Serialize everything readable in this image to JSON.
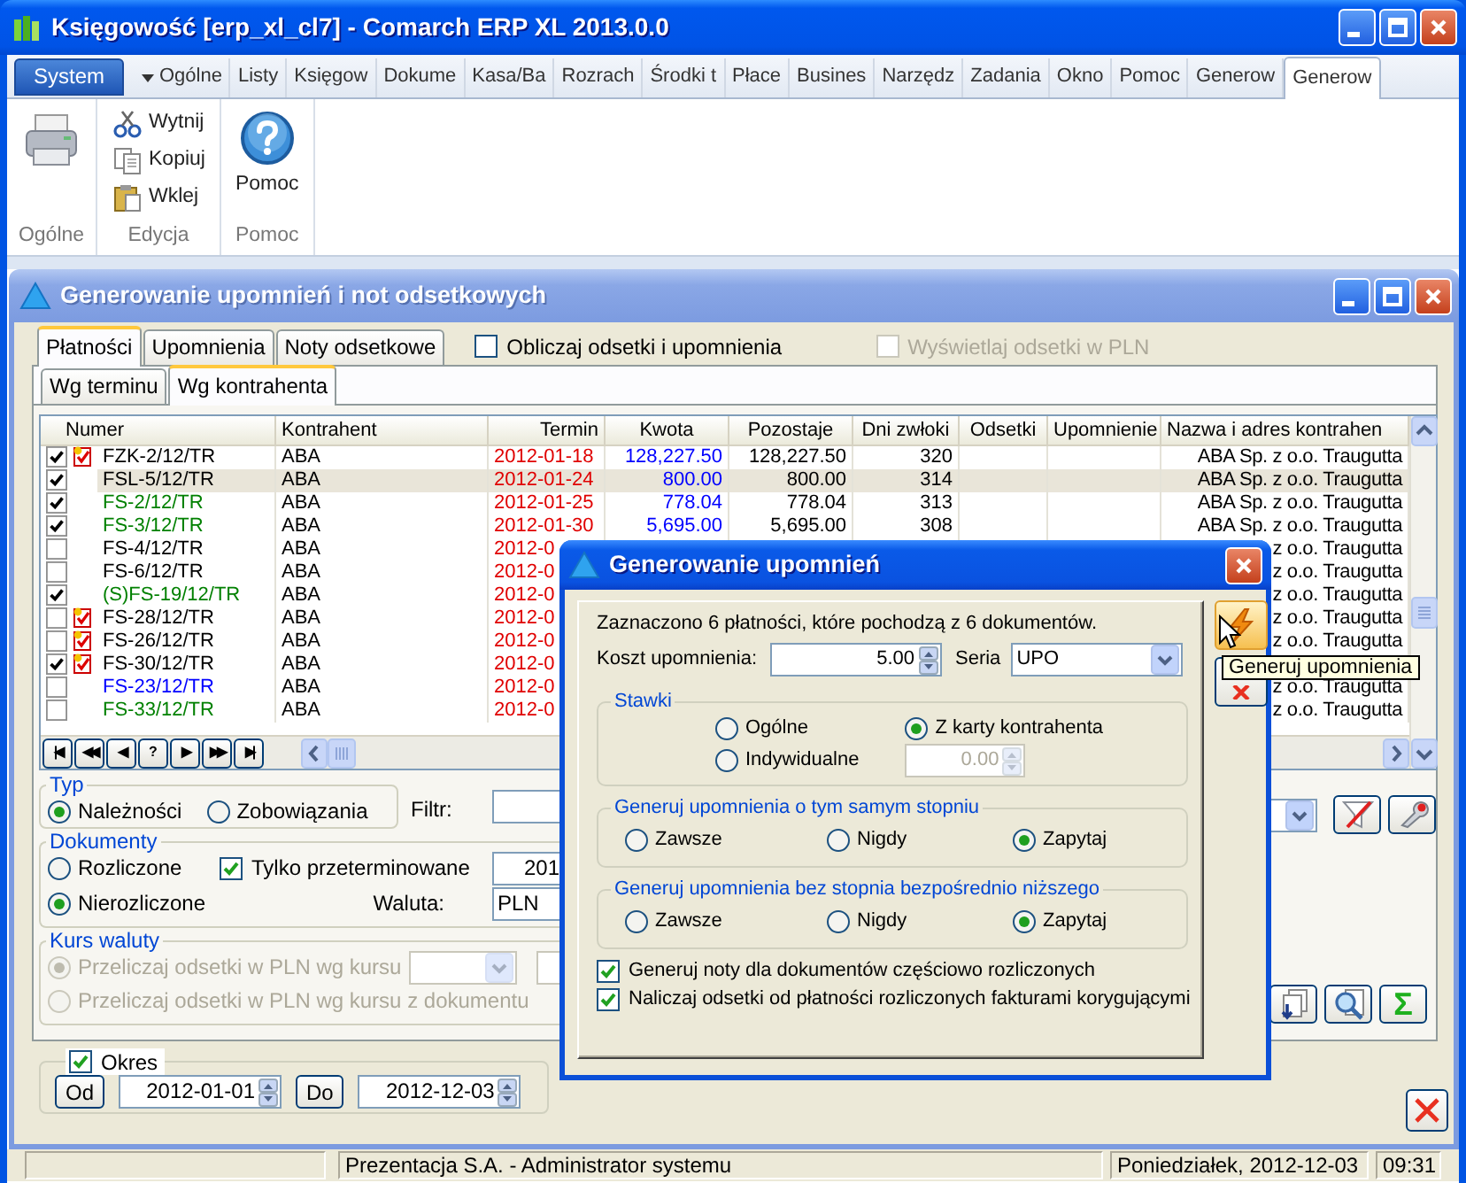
{
  "window": {
    "title": "Księgowość [erp_xl_cl7] - Comarch ERP XL 2013.0.0"
  },
  "ribbon": {
    "system_button": "System",
    "tabs": [
      {
        "label": "Ogólne",
        "kind": "menu",
        "selected": false
      },
      {
        "label": "Listy",
        "kind": "tab",
        "selected": false
      },
      {
        "label": "Księgow",
        "kind": "tab",
        "selected": false
      },
      {
        "label": "Dokume",
        "kind": "tab",
        "selected": false
      },
      {
        "label": "Kasa/Ba",
        "kind": "tab",
        "selected": false
      },
      {
        "label": "Rozrach",
        "kind": "tab",
        "selected": false
      },
      {
        "label": "Środki t",
        "kind": "tab",
        "selected": false
      },
      {
        "label": "Płace",
        "kind": "tab",
        "selected": false
      },
      {
        "label": "Busines",
        "kind": "tab",
        "selected": false
      },
      {
        "label": "Narzędz",
        "kind": "tab",
        "selected": false
      },
      {
        "label": "Zadania",
        "kind": "tab",
        "selected": false
      },
      {
        "label": "Okno",
        "kind": "tab",
        "selected": false
      },
      {
        "label": "Pomoc",
        "kind": "tab",
        "selected": false
      },
      {
        "label": "Generow",
        "kind": "tab",
        "selected": false
      },
      {
        "label": "Generow",
        "kind": "tab",
        "selected": true
      }
    ],
    "groups": [
      {
        "label": "Ogólne",
        "items": [
          {
            "kind": "large"
          }
        ]
      },
      {
        "label": "Edycja",
        "items": [
          {
            "kind": "small",
            "label": "Wytnij"
          },
          {
            "kind": "small",
            "label": "Kopiuj"
          },
          {
            "kind": "small",
            "label": "Wklej"
          }
        ]
      },
      {
        "label": "Pomoc",
        "items": [
          {
            "kind": "large",
            "label": "Pomoc"
          }
        ]
      }
    ]
  },
  "inner_window": {
    "title": "Generowanie upomnień i not odsetkowych",
    "tabs": [
      {
        "label": "Płatności",
        "selected": true
      },
      {
        "label": "Upomnienia",
        "selected": false
      },
      {
        "label": "Noty odsetkowe",
        "selected": false
      }
    ],
    "options": [
      {
        "label": "Obliczaj odsetki i upomnienia",
        "checked": false,
        "disabled": false
      },
      {
        "label": "Wyświetlaj odsetki w PLN",
        "checked": false,
        "disabled": true
      }
    ],
    "subtabs": [
      {
        "label": "Wg terminu",
        "selected": false
      },
      {
        "label": "Wg kontrahenta",
        "selected": true
      }
    ],
    "table": {
      "columns": [
        "Numer",
        "Kontrahent",
        "Termin",
        "Kwota",
        "Pozostaje",
        "Dni zwłoki",
        "Odsetki",
        "Upomnienie",
        "Nazwa i adres kontrahen"
      ],
      "rows": [
        {
          "checked": true,
          "flagged": true,
          "selected": false,
          "numer": "FZK-2/12/TR",
          "color": "#000000",
          "kontrahent": "ABA",
          "termin": "2012-01-18",
          "kwota": "128,227.50",
          "pozostaje": "128,227.50",
          "dni_zwloki": "320",
          "nazwa": "ABA Sp. z o.o. Traugutta"
        },
        {
          "checked": true,
          "flagged": false,
          "selected": true,
          "numer": "FSL-5/12/TR",
          "color": "#000000",
          "kontrahent": "ABA",
          "termin": "2012-01-24",
          "kwota": "800.00",
          "pozostaje": "800.00",
          "dni_zwloki": "314",
          "nazwa": "ABA Sp. z o.o. Traugutta"
        },
        {
          "checked": true,
          "flagged": false,
          "selected": false,
          "numer": "FS-2/12/TR",
          "color": "#008000",
          "kontrahent": "ABA",
          "termin": "2012-01-25",
          "kwota": "778.04",
          "pozostaje": "778.04",
          "dni_zwloki": "313",
          "nazwa": "ABA Sp. z o.o. Traugutta"
        },
        {
          "checked": true,
          "flagged": false,
          "selected": false,
          "numer": "FS-3/12/TR",
          "color": "#008000",
          "kontrahent": "ABA",
          "termin": "2012-01-30",
          "kwota": "5,695.00",
          "pozostaje": "5,695.00",
          "dni_zwloki": "308",
          "nazwa": "ABA Sp. z o.o. Traugutta"
        },
        {
          "checked": false,
          "flagged": false,
          "selected": false,
          "numer": "FS-4/12/TR",
          "color": "#000000",
          "kontrahent": "ABA",
          "termin": "2012-0",
          "nazwa": "z o.o. Traugutta"
        },
        {
          "checked": false,
          "flagged": false,
          "selected": false,
          "numer": "FS-6/12/TR",
          "color": "#000000",
          "kontrahent": "ABA",
          "termin": "2012-0",
          "nazwa": "z o.o. Traugutta"
        },
        {
          "checked": true,
          "flagged": false,
          "selected": false,
          "numer": "(S)FS-19/12/TR",
          "color": "#008000",
          "kontrahent": "ABA",
          "termin": "2012-0",
          "nazwa": "z o.o. Traugutta"
        },
        {
          "checked": false,
          "flagged": true,
          "selected": false,
          "numer": "FS-28/12/TR",
          "color": "#000000",
          "kontrahent": "ABA",
          "termin": "2012-0",
          "nazwa": "z o.o. Traugutta"
        },
        {
          "checked": false,
          "flagged": true,
          "selected": false,
          "numer": "FS-26/12/TR",
          "color": "#000000",
          "kontrahent": "ABA",
          "termin": "2012-0",
          "nazwa": "z o.o. Traugutta"
        },
        {
          "checked": true,
          "flagged": true,
          "selected": false,
          "numer": "FS-30/12/TR",
          "color": "#000000",
          "kontrahent": "ABA",
          "termin": "2012-0"
        },
        {
          "checked": false,
          "flagged": false,
          "selected": false,
          "numer": "FS-23/12/TR",
          "color": "#0000ff",
          "kontrahent": "ABA",
          "termin": "2012-0",
          "nazwa": "z o.o. Traugutta"
        },
        {
          "checked": false,
          "flagged": false,
          "selected": false,
          "numer": "FS-33/12/TR",
          "color": "#008000",
          "kontrahent": "ABA",
          "termin": "2012-0",
          "nazwa": "z o.o. Traugutta"
        }
      ],
      "nav_buttons": [
        "|◀",
        "◀◀",
        "◀",
        "?",
        "▶",
        "▶▶",
        "▶|"
      ]
    },
    "filters": {
      "typ": {
        "legend": "Typ",
        "options": [
          {
            "label": "Należności",
            "selected": true
          },
          {
            "label": "Zobowiązania",
            "selected": false
          }
        ]
      },
      "filtr_label": "Filtr:",
      "dokumenty": {
        "legend": "Dokumenty",
        "options": [
          {
            "label": "Rozliczone",
            "selected": false
          },
          {
            "label": "Nierozliczone",
            "selected": true
          }
        ],
        "overdue": {
          "label": "Tylko przeterminowane",
          "checked": true
        },
        "date_value": "201",
        "waluta_label": "Waluta:",
        "waluta_value": "PLN"
      },
      "kurs": {
        "legend": "Kurs waluty",
        "disabled": true,
        "options": [
          {
            "label": "Przeliczaj odsetki w PLN wg kursu",
            "selected": true
          },
          {
            "label": "Przeliczaj odsetki w PLN wg kursu z dokumentu",
            "selected": false
          }
        ]
      },
      "sum_button": "Σ"
    },
    "okres": {
      "label": "Okres",
      "checked": true,
      "from_button": "Od",
      "from": "2012-01-01",
      "to_button": "Do",
      "to": "2012-12-03"
    }
  },
  "dialog": {
    "title": "Generowanie upomnień",
    "info": "Zaznaczono 6 płatności, które pochodzą z 6 dokumentów.",
    "cost_label": "Koszt upomnienia:",
    "cost": "5.00",
    "seria_label": "Seria",
    "seria": "UPO",
    "stawki": {
      "legend": "Stawki",
      "options": [
        {
          "label": "Ogólne",
          "selected": false
        },
        {
          "label": "Indywidualne",
          "selected": false
        },
        {
          "label": "Z karty kontrahenta",
          "selected": true
        }
      ],
      "value": "0.00"
    },
    "groups": [
      {
        "legend": "Generuj upomnienia o tym samym stopniu",
        "options": [
          {
            "label": "Zawsze",
            "selected": false
          },
          {
            "label": "Nigdy",
            "selected": false
          },
          {
            "label": "Zapytaj",
            "selected": true
          }
        ]
      },
      {
        "legend": "Generuj upomnienia bez stopnia bezpośrednio niższego",
        "options": [
          {
            "label": "Zawsze",
            "selected": false
          },
          {
            "label": "Nigdy",
            "selected": false
          },
          {
            "label": "Zapytaj",
            "selected": true
          }
        ]
      }
    ],
    "checkboxes": [
      {
        "label": "Generuj noty dla dokumentów częściowo rozliczonych",
        "checked": true
      },
      {
        "label": "Naliczaj odsetki od płatności rozliczonych fakturami korygującymi",
        "checked": true
      }
    ],
    "tooltip": "Generuj upomnienia"
  },
  "status_bar": [
    "Prezentacja S.A. - Administrator systemu",
    "Poniedziałek, 2012-12-03",
    "09:31"
  ]
}
